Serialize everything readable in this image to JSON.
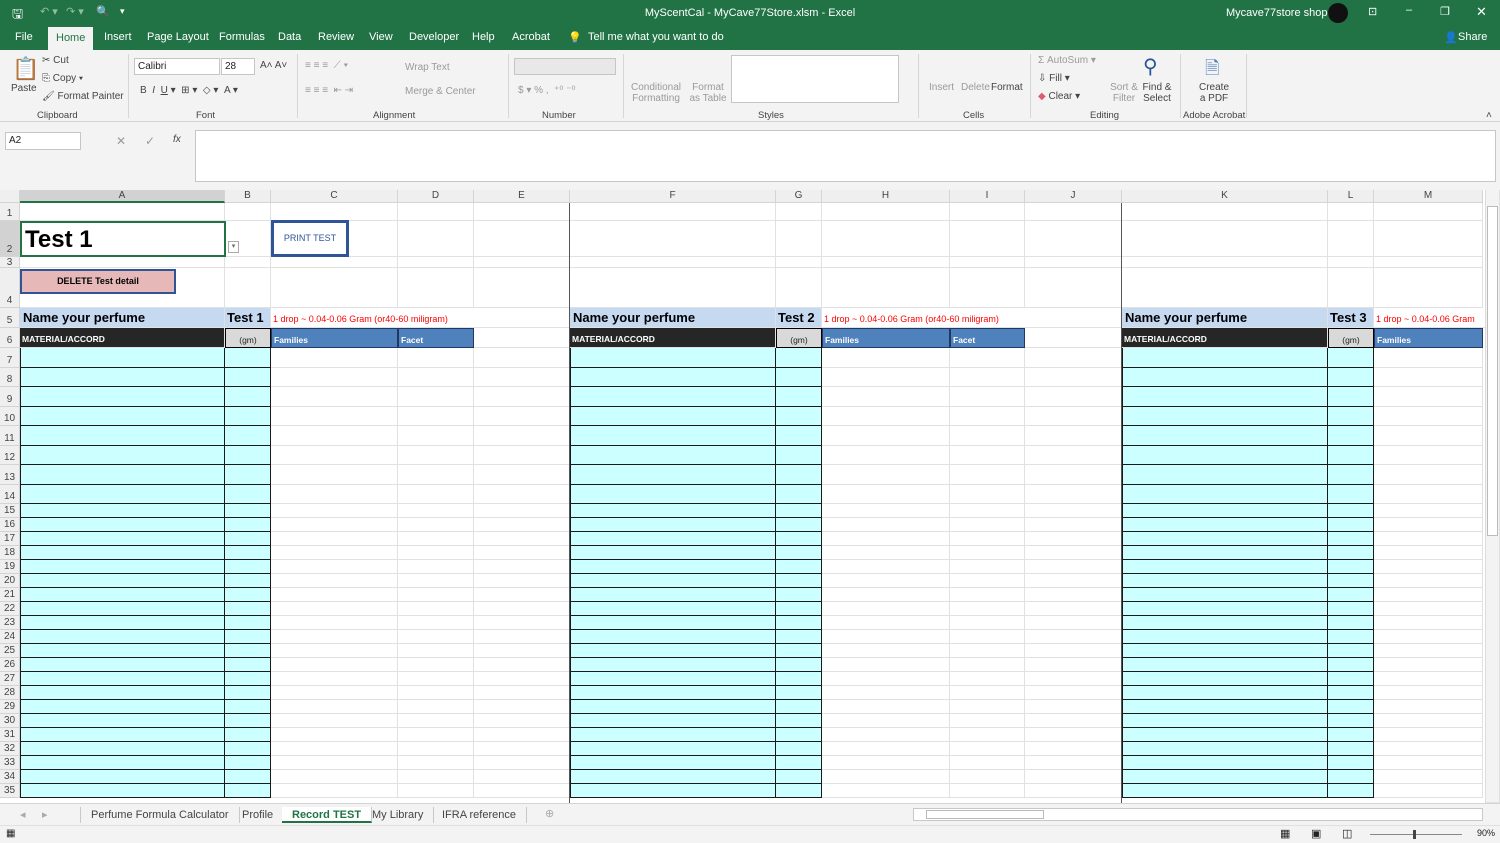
{
  "titlebar": {
    "title": "MyScentCal - MyCave77Store.xlsm  -  Excel",
    "user": "Mycave77store shopee"
  },
  "tabs": [
    "File",
    "Home",
    "Insert",
    "Page Layout",
    "Formulas",
    "Data",
    "Review",
    "View",
    "Developer",
    "Help",
    "Acrobat"
  ],
  "tell_me": "Tell me what you want to do",
  "share": "Share",
  "ribbon": {
    "clipboard": {
      "paste": "Paste",
      "cut": "Cut",
      "copy": "Copy",
      "format_painter": "Format Painter",
      "label": "Clipboard"
    },
    "font": {
      "name": "Calibri",
      "size": "28",
      "label": "Font"
    },
    "alignment": {
      "wrap": "Wrap Text",
      "merge": "Merge & Center",
      "label": "Alignment"
    },
    "number": {
      "label": "Number"
    },
    "styles": {
      "cond": "Conditional Formatting",
      "table": "Format as Table",
      "label": "Styles"
    },
    "cells": {
      "insert": "Insert",
      "delete": "Delete",
      "format": "Format",
      "label": "Cells"
    },
    "editing": {
      "autosum": "AutoSum",
      "fill": "Fill",
      "clear": "Clear",
      "sort": "Sort & Filter",
      "find": "Find & Select",
      "label": "Editing"
    },
    "acrobat": {
      "create": "Create a PDF",
      "label": "Adobe Acrobat"
    }
  },
  "formula_bar": {
    "name_box": "A2",
    "formula": ""
  },
  "columns": [
    "A",
    "B",
    "C",
    "D",
    "E",
    "F",
    "G",
    "H",
    "I",
    "J",
    "K",
    "L",
    "M"
  ],
  "sheet": {
    "title_cell": "Test 1",
    "print_button": "PRINT TEST",
    "delete_button": "DELETE Test detail",
    "blocks": [
      {
        "name_label": "Name your perfume",
        "test": "Test 1",
        "note": "1 drop ~ 0.04-0.06 Gram (or40-60 miligram)",
        "material": "MATERIAL/ACCORD",
        "gm": "(gm)",
        "families": "Families",
        "facet": "Facet"
      },
      {
        "name_label": "Name your perfume",
        "test": "Test 2",
        "note": "1 drop ~ 0.04-0.06 Gram (or40-60 miligram)",
        "material": "MATERIAL/ACCORD",
        "gm": "(gm)",
        "families": "Families",
        "facet": "Facet"
      },
      {
        "name_label": "Name your perfume",
        "test": "Test 3",
        "note": "1 drop ~ 0.04-0.06 Gram",
        "material": "MATERIAL/ACCORD",
        "gm": "(gm)",
        "families": "Families"
      }
    ]
  },
  "sheet_tabs": [
    "Perfume Formula Calculator",
    "Profile",
    "Record TEST",
    "My Library",
    "IFRA reference"
  ],
  "active_sheet": "Record TEST",
  "zoom": "90%",
  "colors": {
    "excel_green": "#217346",
    "material_fill": "#ccffff",
    "header_blue": "#c5d9f1",
    "families_blue": "#4f81bd",
    "delete_pink": "#e6b8b7",
    "note_red": "#ff0000"
  }
}
